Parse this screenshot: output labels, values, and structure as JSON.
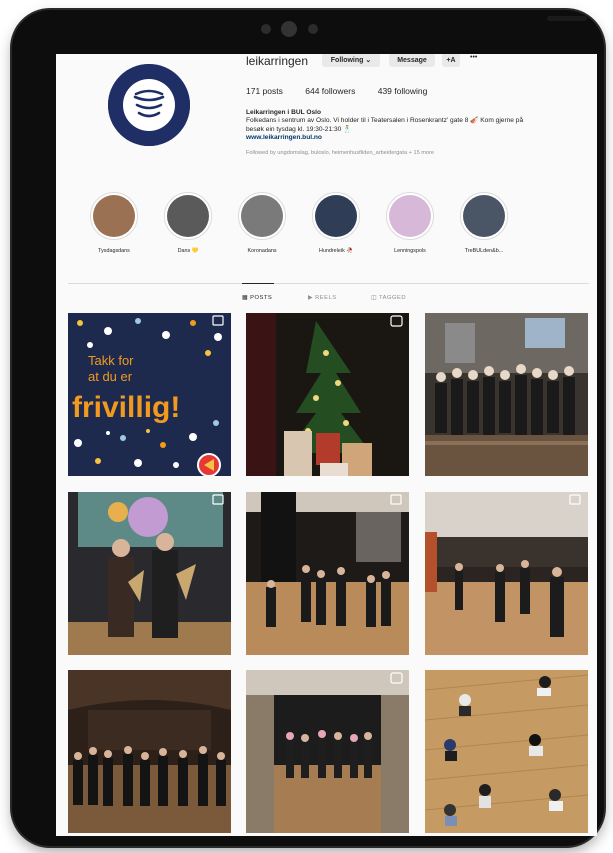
{
  "profile": {
    "username": "leikarringen",
    "following_label": "Following ⌄",
    "message_label": "Message",
    "add_label": "+A",
    "more_label": "•••",
    "posts": "171 posts",
    "followers": "644 followers",
    "following": "439 following",
    "display_name": "Leikarringen i BUL Oslo",
    "bio_line1": "Folkedans i sentrum av Oslo. Vi holder til i Teatersalen i Rosenkrantz' gate 8 🎻 Kom gjerne på",
    "bio_line2": "besøk ein tysdag kl. 19:30-21:30 🕺",
    "link": "www.leikarringen.bul.no",
    "followed_by": "Followed by ungdomslag, buloslo, heimenhusfliden_arbeidergata + 15 more"
  },
  "highlights": [
    {
      "label": "Tysdagsdans",
      "color": "#9b7154"
    },
    {
      "label": "Dans 💛",
      "color": "#5a5a5a"
    },
    {
      "label": "Koronadans",
      "color": "#7a7a7a"
    },
    {
      "label": "Hundreleik 🥀",
      "color": "#2f3e56"
    },
    {
      "label": "Lenningspols",
      "color": "#d7b8d8"
    },
    {
      "label": "TreBULden&b...",
      "color": "#4a5566"
    }
  ],
  "tabs": {
    "posts": "▦ POSTS",
    "reels": "▶ REELS",
    "tagged": "◫ TAGGED"
  },
  "posts": [
    {
      "kind": "text-poster",
      "line1": "Takk for",
      "line2": "at du er",
      "line3": "frivillig!",
      "bg": "#1d2a4e",
      "accent": "#f29a1f"
    },
    {
      "kind": "christmas-tree",
      "bg": "#1a1612"
    },
    {
      "kind": "group-photo",
      "bg": "#3a3430"
    },
    {
      "kind": "award-photo",
      "bg": "#2a2a2e"
    },
    {
      "kind": "dance-hall",
      "bg": "#6b4c33"
    },
    {
      "kind": "dance-hall-wide",
      "bg": "#7a5a3f"
    },
    {
      "kind": "ballroom",
      "bg": "#2c2018"
    },
    {
      "kind": "doorway-dance",
      "bg": "#3b2c22"
    },
    {
      "kind": "overhead",
      "bg": "#c59a63"
    }
  ]
}
